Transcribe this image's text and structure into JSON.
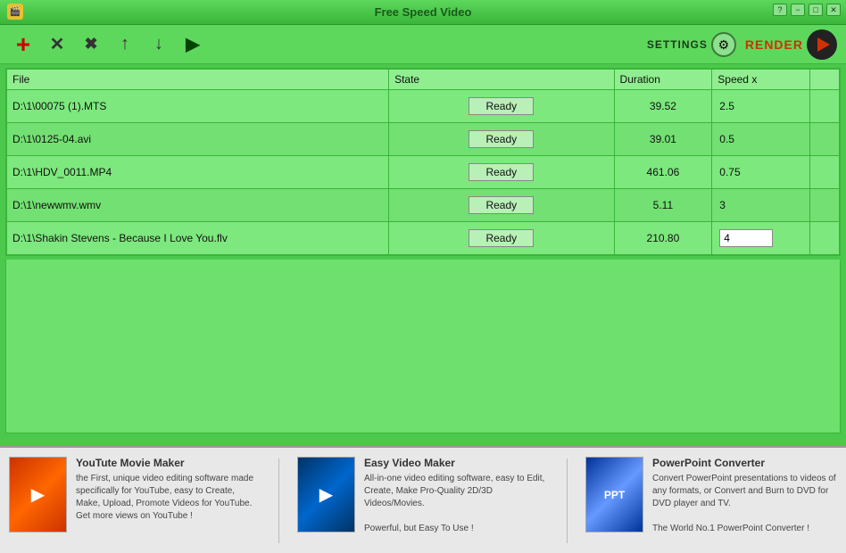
{
  "titlebar": {
    "title": "Free Speed Video",
    "icon": "🎬",
    "controls": [
      "?",
      "−",
      "□",
      "✕"
    ]
  },
  "toolbar": {
    "buttons": [
      {
        "name": "add",
        "symbol": "+",
        "label": "Add file"
      },
      {
        "name": "remove",
        "symbol": "✕",
        "label": "Remove file"
      },
      {
        "name": "clear",
        "symbol": "✖",
        "label": "Clear all"
      },
      {
        "name": "move-up",
        "symbol": "↑",
        "label": "Move up"
      },
      {
        "name": "move-down",
        "symbol": "↓",
        "label": "Move down"
      },
      {
        "name": "play",
        "symbol": "▶",
        "label": "Play"
      }
    ],
    "settings_label": "Settings",
    "render_label": "Render"
  },
  "table": {
    "headers": [
      "File",
      "State",
      "Duration",
      "Speed x",
      ""
    ],
    "rows": [
      {
        "file": "D:\\1\\00075 (1).MTS",
        "state": "Ready",
        "duration": "39.52",
        "speed": "2.5"
      },
      {
        "file": "D:\\1\\0125-04.avi",
        "state": "Ready",
        "duration": "39.01",
        "speed": "0.5"
      },
      {
        "file": "D:\\1\\HDV_0011.MP4",
        "state": "Ready",
        "duration": "461.06",
        "speed": "0.75"
      },
      {
        "file": "D:\\1\\newwmv.wmv",
        "state": "Ready",
        "duration": "5.11",
        "speed": "3"
      },
      {
        "file": "D:\\1\\Shakin Stevens - Because I Love You.flv",
        "state": "Ready",
        "duration": "210.80",
        "speed": "4"
      }
    ]
  },
  "ads": [
    {
      "title": "YouTute Movie Maker",
      "description": "the First, unique video editing software made specifically for YouTube, easy to Create, Make, Upload, Promote Videos for YouTube.\nGet more views on YouTube !",
      "thumb_type": "yt"
    },
    {
      "title": "Easy Video Maker",
      "description": "All-in-one video editing software, easy to Edit, Create, Make Pro-Quality 2D/3D Videos/Movies.\n\nPowerful, but Easy To Use !",
      "thumb_type": "ev"
    },
    {
      "title": "PowerPoint Converter",
      "description": "Convert PowerPoint presentations to videos of any formats, or Convert and Burn to DVD for DVD player and TV.\n\nThe World No.1 PowerPoint Converter !",
      "thumb_type": "pp"
    }
  ]
}
